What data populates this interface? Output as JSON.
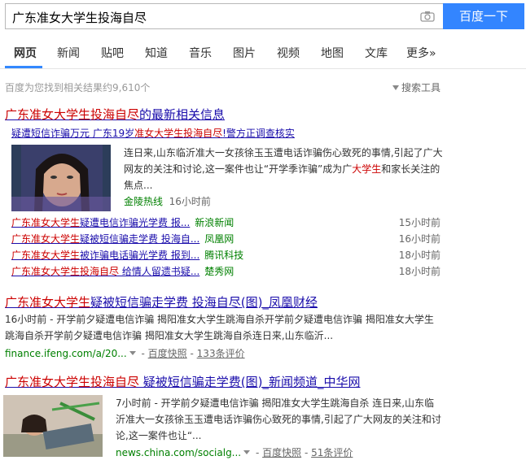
{
  "search": {
    "query": "广东准女大学生投海自尽",
    "button": "百度一下"
  },
  "tabs": [
    "网页",
    "新闻",
    "贴吧",
    "知道",
    "音乐",
    "图片",
    "视频",
    "地图",
    "文库",
    "更多»"
  ],
  "result_count": "百度为您找到相关结果约9,610个",
  "search_tools": "搜索工具",
  "news_block": {
    "title_hl": "广东准女大学生投海自尽",
    "title_rest": "的最新相关信息",
    "top_link_a": "疑遭短信诈骗万元 广东",
    "top_link_b": "19岁",
    "top_link_hl": "准女大学生投海自尽",
    "top_link_c": "!警方正调查核实",
    "snippet_a": "连日来,山东临沂准大一女孩徐玉玉遭电话诈骗伤心致死的事情,引起了广大网友的关注和讨论,这一案件也让“开学季诈骗”成为广",
    "snippet_hl": "大学生",
    "snippet_b": "和家长关注的焦点...",
    "source": "金陵热线",
    "time": "16小时前",
    "items": [
      {
        "hl": "广东准女大学生",
        "rest": "疑遭电信诈骗光学费 报...",
        "src": "新浪新闻",
        "time": "15小时前"
      },
      {
        "hl": "广东准女大学生",
        "rest": "疑被短信骗走学费 投海自...",
        "src": "凤凰网",
        "time": "16小时前"
      },
      {
        "hl": "广东准女大学生",
        "rest": "被诈骗电话骗光学费 报到...",
        "src": "腾讯科技",
        "time": "18小时前"
      },
      {
        "hl": "广东准女大学生投海自尽",
        "rest": " 给情人留遗书疑...",
        "src": "楚秀网",
        "time": "18小时前"
      }
    ]
  },
  "result2": {
    "title_hl": "广东准女大学生",
    "title_rest": "疑被短信骗走学费 投海自尽(图)_凤凰财经",
    "snippet": "16小时前 - 开学前夕疑遭电信诈骗 揭阳准女大学生跳海自杀开学前夕疑遭电信诈骗 揭阳准女大学生跳海自杀开学前夕疑遭电信诈骗 揭阳准女大学生跳海自杀连日来,山东临沂...",
    "url": "finance.ifeng.com/a/20...",
    "cache": "百度快照",
    "reviews": "133条评价"
  },
  "result3": {
    "title_hl": "广东准女大学生投海自尽",
    "title_rest": " 疑被短信骗走学费(图)_新闻频道_中华网",
    "snippet": "7小时前 - 开学前夕疑遭电信诈骗 揭阳准女大学生跳海自杀 连日来,山东临沂准大一女孩徐玉玉遭电话诈骗伤心致死的事情,引起了广大网友的关注和讨论,这一案件也让“...",
    "url": "news.china.com/socialg...",
    "cache": "百度快照",
    "reviews": "51条评价"
  }
}
